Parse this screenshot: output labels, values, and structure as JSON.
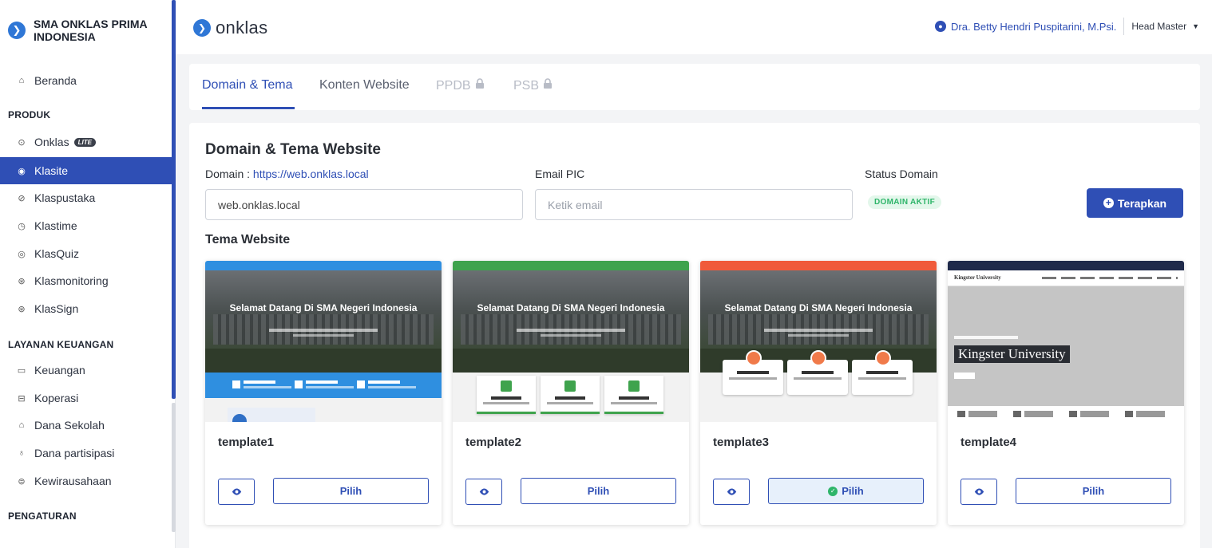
{
  "sidebar": {
    "school_name": "SMA ONKLAS PRIMA INDONESIA",
    "items": {
      "beranda": "Beranda",
      "onklas": "Onklas",
      "onklas_badge": "LITE",
      "klasite": "Klasite",
      "klaspustaka": "Klaspustaka",
      "klastime": "Klastime",
      "klasquiz": "KlasQuiz",
      "klasmonitoring": "Klasmonitoring",
      "klassign": "KlasSign",
      "keuangan": "Keuangan",
      "koperasi": "Koperasi",
      "dana_sekolah": "Dana Sekolah",
      "dana_partisipasi": "Dana partisipasi",
      "kewirausahaan": "Kewirausahaan"
    },
    "sections": {
      "produk": "PRODUK",
      "layanan": "LAYANAN KEUANGAN",
      "pengaturan": "PENGATURAN"
    },
    "active_item": "Klasite"
  },
  "topbar": {
    "logo_text": "onklas",
    "user_name": "Dra. Betty Hendri Puspitarini, M.Psi.",
    "role": "Head Master"
  },
  "tabs": {
    "domain_tema": "Domain & Tema",
    "konten": "Konten Website",
    "ppdb": "PPDB",
    "psb": "PSB",
    "active": "Domain & Tema"
  },
  "main": {
    "title": "Domain & Tema Website",
    "domain_label": "Domain : ",
    "domain_link": "https://web.onklas.local",
    "domain_value": "web.onklas.local",
    "email_label": "Email PIC",
    "email_placeholder": "Ketik email",
    "status_label": "Status Domain",
    "status_badge": "DOMAIN AKTIF",
    "apply_label": "Terapkan",
    "tema_title": "Tema Website"
  },
  "templates": [
    {
      "name": "template1",
      "pick_label": "Pilih",
      "selected": false,
      "accent": "#2f8fe0",
      "hero_title": "Selamat Datang Di SMA Negeri Indonesia"
    },
    {
      "name": "template2",
      "pick_label": "Pilih",
      "selected": false,
      "accent": "#3fa34d",
      "hero_title": "Selamat Datang Di SMA Negeri Indonesia"
    },
    {
      "name": "template3",
      "pick_label": "Pilih",
      "selected": true,
      "accent": "#f05a3a",
      "hero_title": "Selamat Datang Di SMA Negeri Indonesia"
    },
    {
      "name": "template4",
      "pick_label": "Pilih",
      "selected": false,
      "accent": "#1f2a4a",
      "hero_title": "Kingster University",
      "brand": "Kingster University"
    }
  ],
  "colors": {
    "primary": "#2f4fb5",
    "success": "#2fb56a"
  }
}
